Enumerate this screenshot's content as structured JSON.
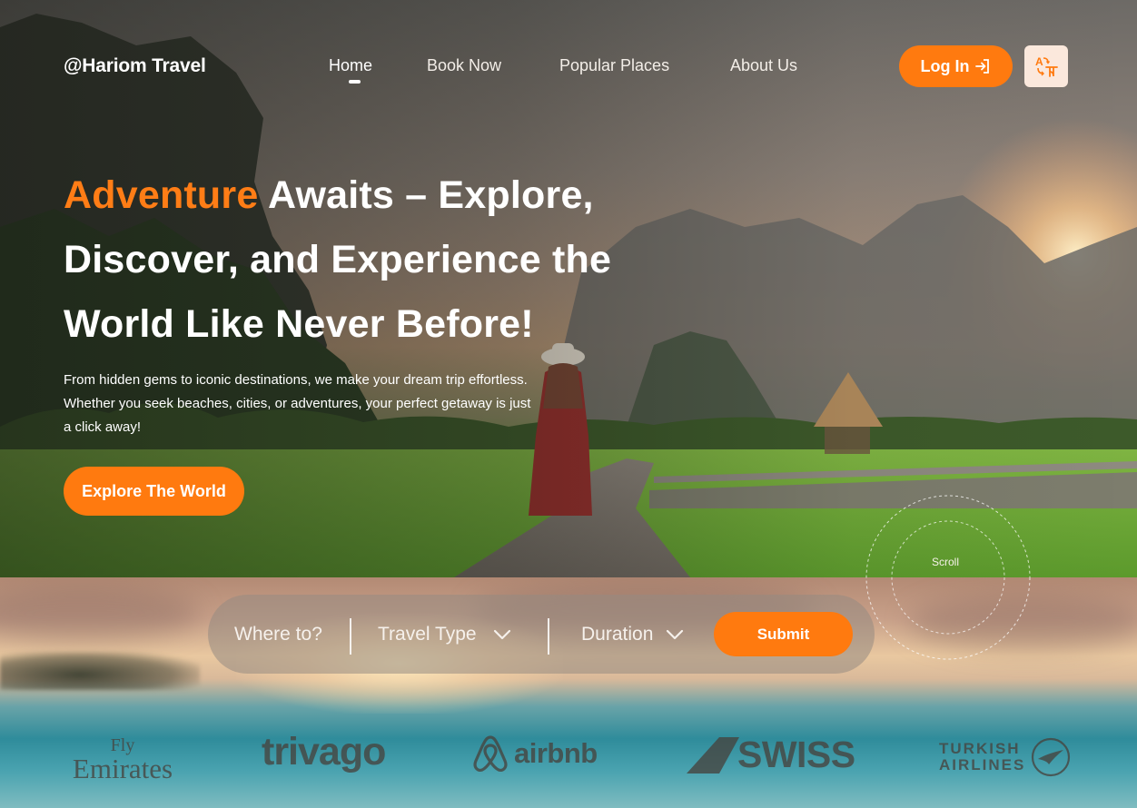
{
  "brand": {
    "name": "@Hariom Travel"
  },
  "nav": {
    "items": [
      {
        "label": "Home",
        "active": true
      },
      {
        "label": "Book Now",
        "active": false
      },
      {
        "label": "Popular Places",
        "active": false
      },
      {
        "label": "About Us",
        "active": false
      }
    ],
    "login_label": "Log In",
    "login_icon": "login-arrow-icon",
    "language_icon": "translate-icon"
  },
  "hero": {
    "headline_accent": "Adventure",
    "headline_line1_rest": " Awaits – Explore,",
    "headline_line2": "Discover, and Experience the",
    "headline_line3": "World Like Never Before!",
    "subtext": "From hidden gems to iconic destinations, we make your dream trip effortless. Whether you seek beaches, cities, or adventures, your perfect getaway is just a click away!",
    "cta_label": "Explore The World",
    "scroll_label": "Scroll"
  },
  "search": {
    "where_placeholder": "Where to?",
    "travel_type_label": "Travel Type",
    "duration_label": "Duration",
    "submit_label": "Submit"
  },
  "partners": {
    "emirates_line1": "Fly",
    "emirates_line2": "Emirates",
    "trivago": "trivago",
    "airbnb": "airbnb",
    "swiss": "SWISS",
    "turkish_line1": "TURKISH",
    "turkish_line2": "AIRLINES"
  },
  "colors": {
    "accent": "#ff7a0f",
    "text_light": "#ffffff",
    "language_button_bg": "#fbe8dc"
  }
}
